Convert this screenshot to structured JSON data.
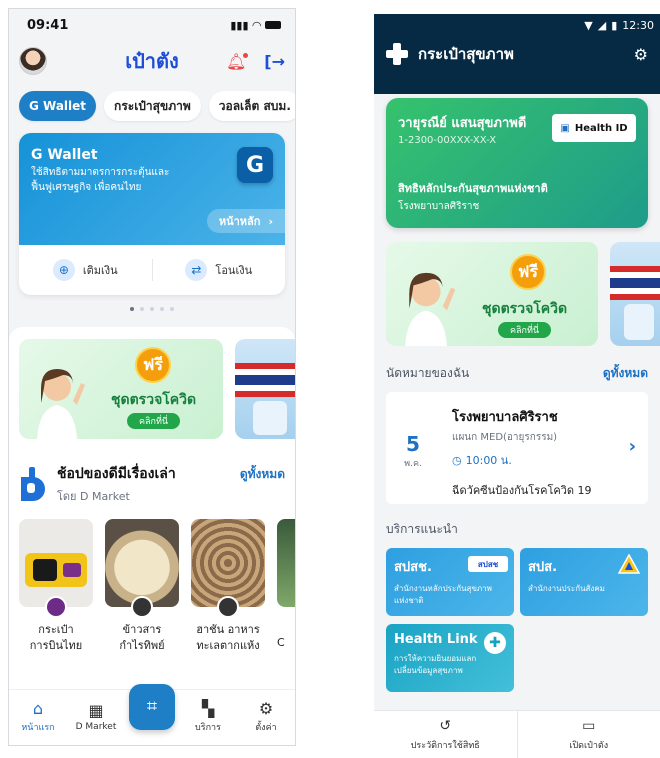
{
  "left": {
    "status_time": "09:41",
    "title": "เป๋าตัง",
    "tabs": [
      {
        "label": "G Wallet"
      },
      {
        "label": "กระเป๋าสุขภาพ"
      },
      {
        "label": "วอลเล็ต สบม."
      }
    ],
    "wallet": {
      "title": "G Wallet",
      "desc": "ใช้สิทธิตามมาตรการกระตุ้นและฟื้นฟูเศรษฐกิจ เพื่อคนไทย",
      "badge": "G",
      "home_label": "หน้าหลัก",
      "topup_label": "เติมเงิน",
      "transfer_label": "โอนเงิน"
    },
    "banner": {
      "free": "ฟรี",
      "text": "ชุดตรวจโควิด",
      "click": "คลิกที่นี่"
    },
    "dmarket": {
      "title": "ช้อปของดีมีเรื่องเล่า",
      "subtitle": "โดย D Market",
      "see_all": "ดูทั้งหมด",
      "products": [
        {
          "line1": "กระเป๋า",
          "line2": "การบินไทย"
        },
        {
          "line1": "ข้าวสาร",
          "line2": "กำไรทิพย์"
        },
        {
          "line1": "ฮาชัน อาหาร",
          "line2": "ทะเลตากแห้ง"
        },
        {
          "line1": "C",
          "line2": ""
        }
      ]
    },
    "nav": {
      "home": "หน้าแรก",
      "dmarket": "D Market",
      "services": "บริการ",
      "settings": "ตั้งค่า"
    }
  },
  "right": {
    "status_time": "12:30",
    "title": "กระเป๋าสุขภาพ",
    "card": {
      "name": "วายุรณีย์ แสนสุขภาพดี",
      "id": "1-2300-00XXX-XX-X",
      "health_id": "Health ID",
      "right_label": "สิทธิหลักประกันสุขภาพแห่งชาติ",
      "hospital": "โรงพยาบาลศิริราช"
    },
    "banner": {
      "free": "ฟรี",
      "text": "ชุดตรวจโควิด",
      "click": "คลิกที่นี่"
    },
    "appointments": {
      "heading": "นัดหมายของฉัน",
      "see_all": "ดูทั้งหมด",
      "day": "5",
      "month": "พ.ค.",
      "hospital": "โรงพยาบาลศิริราช",
      "dept": "แผนก MED(อายุรกรรม)",
      "time": "10:00 น.",
      "desc": "ฉีดวัคซีนป้องกันโรคโควิด 19"
    },
    "services": {
      "heading": "บริการแนะนำ",
      "items": [
        {
          "title": "สปสช.",
          "desc": "สำนักงานหลักประกันสุขภาพแห่งชาติ",
          "logo": "สปสช"
        },
        {
          "title": "สปส.",
          "desc": "สำนักงานประกันสังคม"
        },
        {
          "title": "Health Link",
          "desc": "การให้ความยินยอมแลกเปลี่ยนข้อมูลสุขภาพ"
        }
      ]
    },
    "nav": {
      "history": "ประวัติการใช้สิทธิ",
      "open_wallet": "เปิดเป๋าตัง"
    }
  }
}
